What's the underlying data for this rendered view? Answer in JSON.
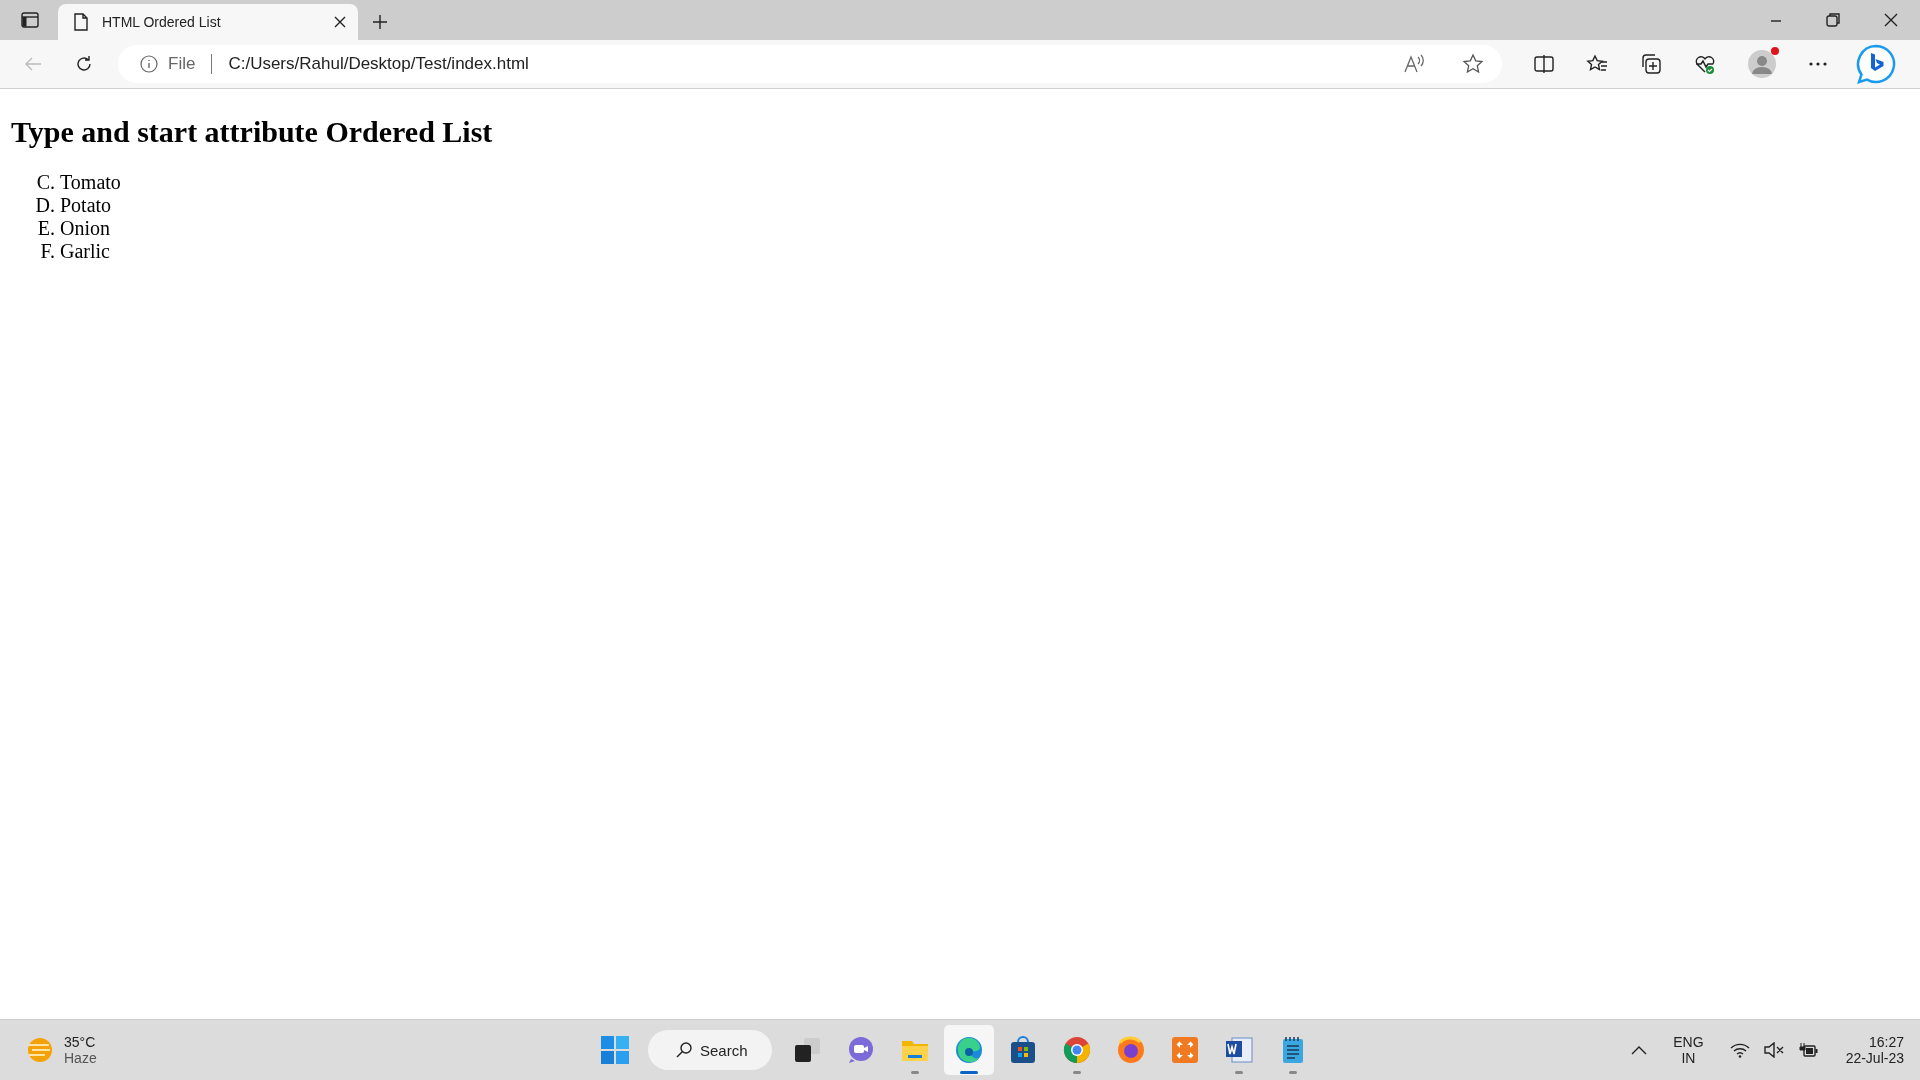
{
  "browser": {
    "tabs": [
      {
        "title": "HTML Ordered List",
        "selected": true
      }
    ],
    "address_bar": {
      "scheme_label": "File",
      "url": "C:/Users/Rahul/Desktop/Test/index.html"
    },
    "profile": {
      "notification": true
    }
  },
  "page": {
    "heading": "Type and start attribute Ordered List",
    "list_items": [
      {
        "marker": "C.",
        "text": "Tomato"
      },
      {
        "marker": "D.",
        "text": "Potato"
      },
      {
        "marker": "E.",
        "text": "Onion"
      },
      {
        "marker": "F.",
        "text": "Garlic"
      }
    ]
  },
  "taskbar": {
    "weather": {
      "temperature": "35°C",
      "condition": "Haze"
    },
    "search": {
      "label": "Search"
    },
    "apps": [
      {
        "running": false,
        "selected": false
      },
      {
        "running": false,
        "selected": false
      },
      {
        "running": true,
        "selected": false
      },
      {
        "running": true,
        "selected": true
      },
      {
        "running": false,
        "selected": false
      },
      {
        "running": true,
        "selected": false
      },
      {
        "running": false,
        "selected": false
      },
      {
        "running": false,
        "selected": false
      },
      {
        "running": true,
        "selected": false
      },
      {
        "running": true,
        "selected": false
      }
    ],
    "language": {
      "line1": "ENG",
      "line2": "IN"
    },
    "clock": {
      "time": "16:27",
      "date": "22-Jul-23"
    }
  }
}
